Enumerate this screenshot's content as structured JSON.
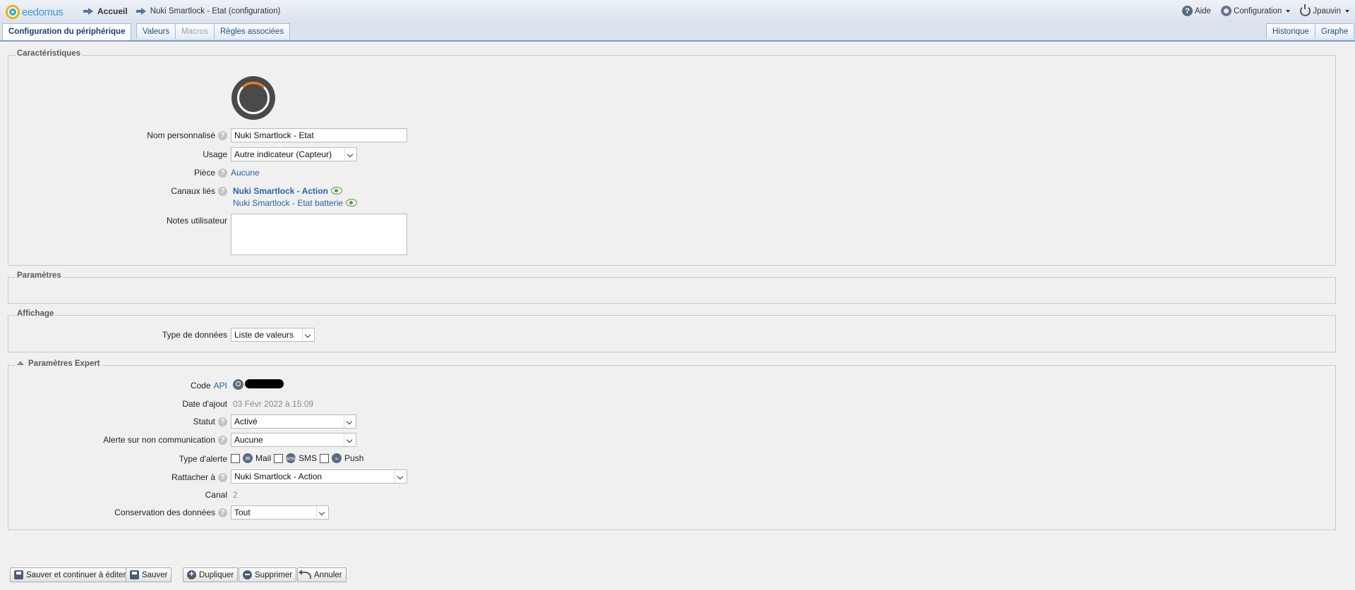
{
  "app": {
    "logo": "eedomus"
  },
  "breadcrumb": {
    "home": "Accueil",
    "current": "Nuki Smartlock - Etat (configuration)"
  },
  "topright": {
    "help": "Aide",
    "config": "Configuration",
    "user": "Jpauvin"
  },
  "tabs": {
    "left": [
      "Configuration du périphérique",
      "Valeurs",
      "Macros",
      "Règles associées"
    ],
    "right": [
      "Historique",
      "Graphe"
    ]
  },
  "caracteristiques": {
    "legend": "Caractéristiques",
    "nom_label": "Nom personnalisé",
    "nom_value": "Nuki Smartlock - Etat",
    "usage_label": "Usage",
    "usage_value": "Autre indicateur (Capteur)",
    "piece_label": "Pièce",
    "piece_value": "Aucune",
    "canaux_label": "Canaux liés",
    "canaux": [
      "Nuki Smartlock - Action",
      "Nuki Smartlock - Etat batterie"
    ],
    "notes_label": "Notes utilisateur"
  },
  "parametres": {
    "legend": "Paramètres"
  },
  "affichage": {
    "legend": "Affichage",
    "type_label": "Type de données",
    "type_value": "Liste de valeurs"
  },
  "expert": {
    "legend": "Paramètres Expert",
    "code_label": "Code",
    "code_link": "API",
    "date_label": "Date d'ajout",
    "date_value": "03 Févr 2022 à 15:09",
    "statut_label": "Statut",
    "statut_value": "Activé",
    "alerte_label": "Alerte sur non communication",
    "alerte_value": "Aucune",
    "type_alerte_label": "Type d'alerte",
    "mail": "Mail",
    "sms": "SMS",
    "push": "Push",
    "rattacher_label": "Rattacher à",
    "rattacher_value": "Nuki Smartlock - Action",
    "canal_label": "Canal",
    "canal_value": "2",
    "conservation_label": "Conservation des données",
    "conservation_value": "Tout"
  },
  "buttons": {
    "save_continue": "Sauver et continuer à éditer",
    "save": "Sauver",
    "duplicate": "Dupliquer",
    "delete": "Supprimer",
    "cancel": "Annuler"
  }
}
